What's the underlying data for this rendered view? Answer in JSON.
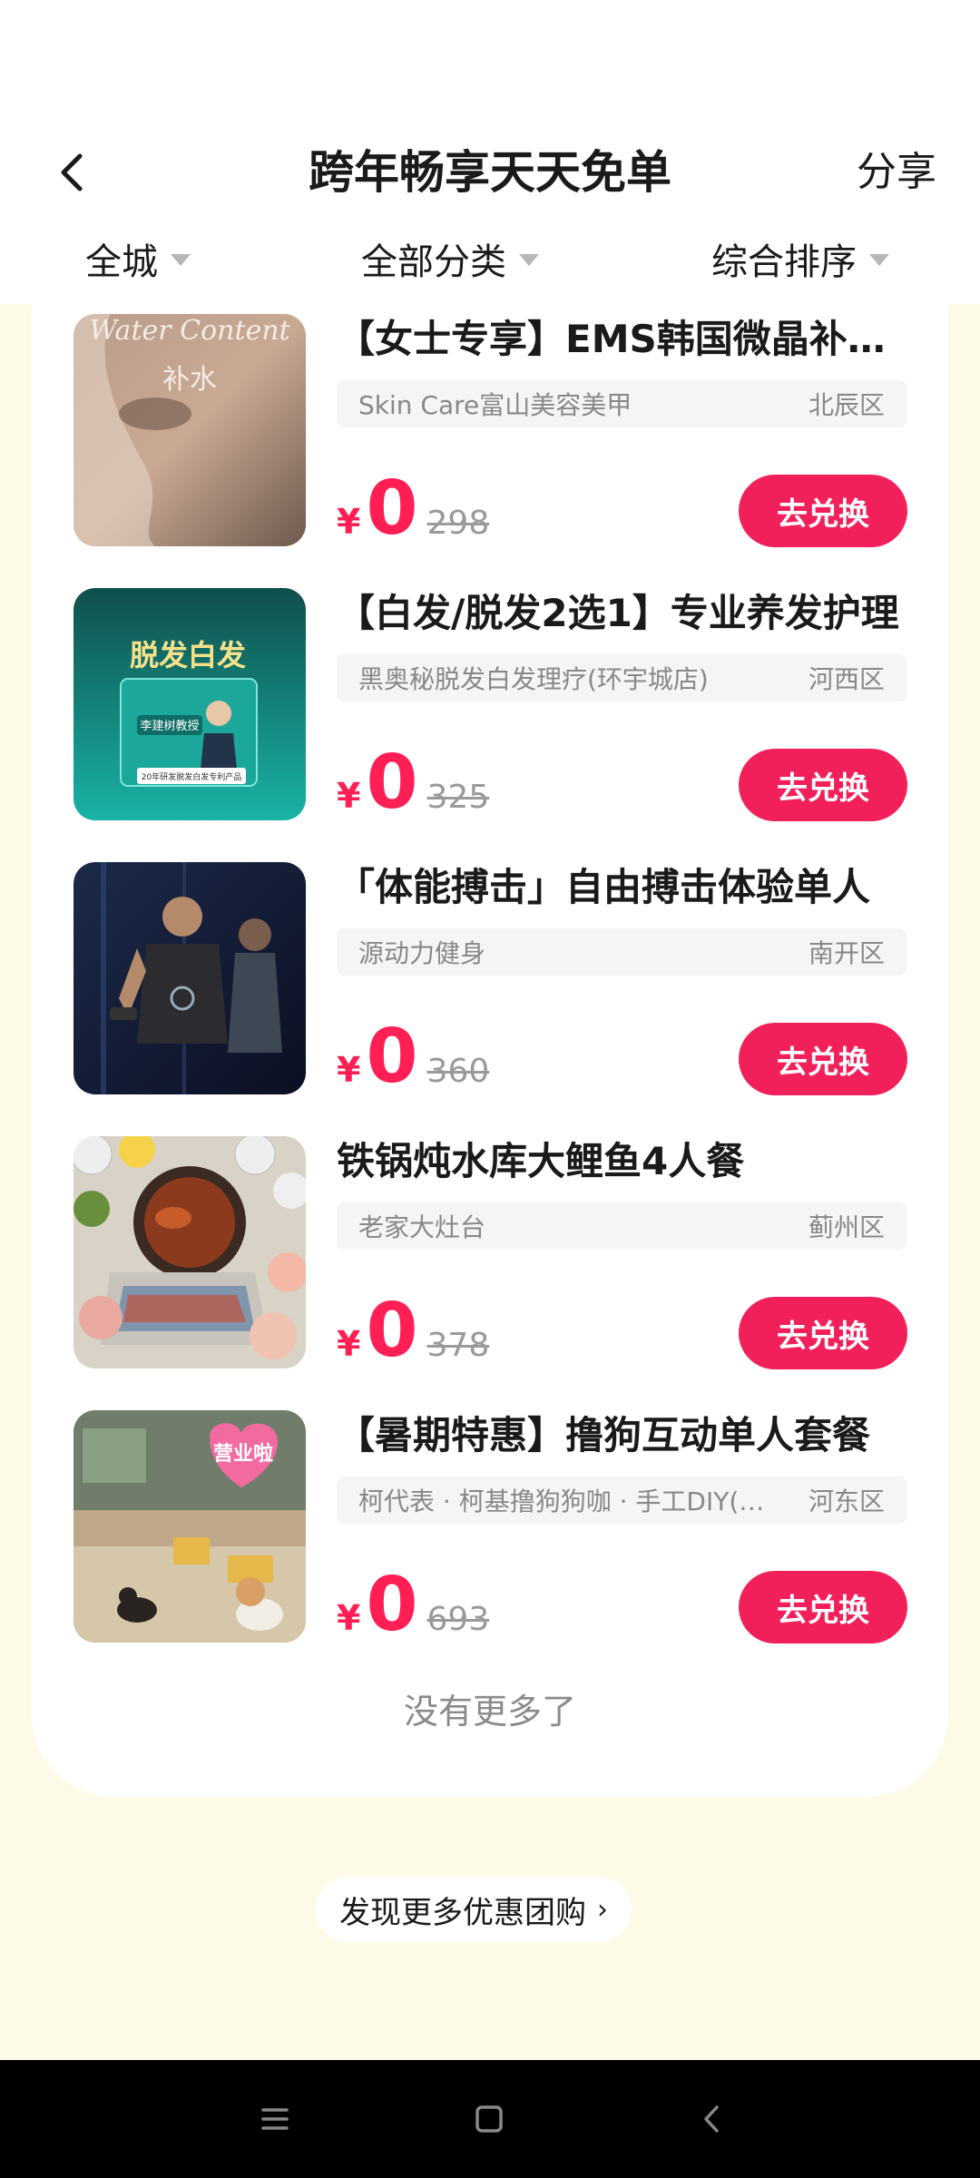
{
  "header": {
    "title": "跨年畅享天天免单",
    "share_label": "分享"
  },
  "filters": [
    {
      "label": "全城"
    },
    {
      "label": "全部分类"
    },
    {
      "label": "综合排序"
    }
  ],
  "items": [
    {
      "title": "【女士专享】EMS韩国微晶补水护理",
      "store": "Skin Care富山美容美甲",
      "district": "北辰区",
      "currency": "¥",
      "price": "0",
      "original_price": "298",
      "button_label": "去兑换",
      "image_text": [
        "Water Content",
        "补水"
      ]
    },
    {
      "title": "【白发/脱发2选1】专业养发护理",
      "store": "黑奥秘脱发白发理疗(环宇城店)",
      "district": "河西区",
      "currency": "¥",
      "price": "0",
      "original_price": "325",
      "button_label": "去兑换",
      "image_text": [
        "脱发白发",
        "李建树教授",
        "20年研发脱发白发专利产品"
      ]
    },
    {
      "title": "「体能搏击」自由搏击体验单人",
      "store": "源动力健身",
      "district": "南开区",
      "currency": "¥",
      "price": "0",
      "original_price": "360",
      "button_label": "去兑换"
    },
    {
      "title": "铁锅炖水库大鲤鱼4人餐",
      "store": "老家大灶台",
      "district": "蓟州区",
      "currency": "¥",
      "price": "0",
      "original_price": "378",
      "button_label": "去兑换"
    },
    {
      "title": "【暑期特惠】撸狗互动单人套餐",
      "store": "柯代表 · 柯基撸狗狗咖 · 手工DIY(…",
      "district": "河东区",
      "currency": "¥",
      "price": "0",
      "original_price": "693",
      "button_label": "去兑换",
      "image_text": [
        "营业啦"
      ]
    }
  ],
  "footer": {
    "no_more": "没有更多了",
    "discover_label": "发现更多优惠团购"
  },
  "colors": {
    "accent": "#f2205a",
    "price": "#ff1f55",
    "background": "#fdfbe8"
  },
  "icons": {
    "back": "chevron-left-icon",
    "caret": "caret-down-icon",
    "nav": [
      "menu-icon",
      "home-square-icon",
      "back-triangle-icon"
    ]
  }
}
